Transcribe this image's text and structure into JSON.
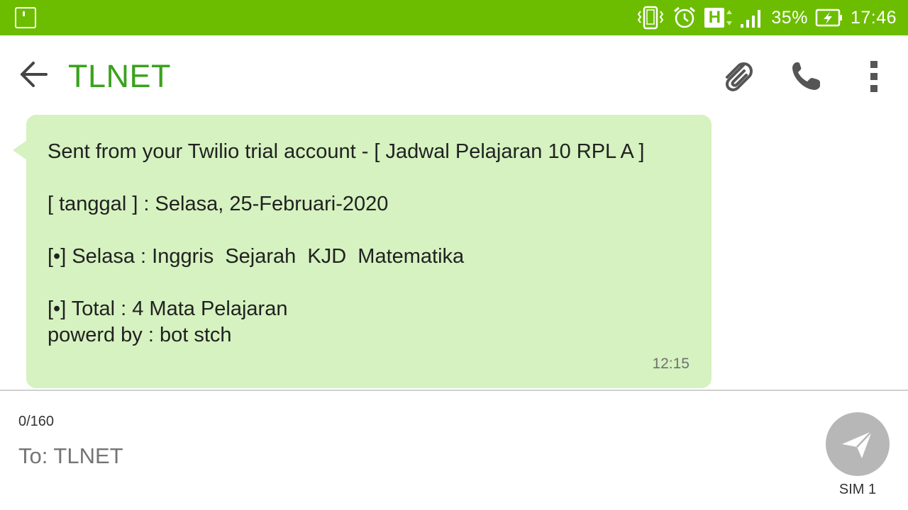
{
  "status_bar": {
    "battery_percent": "35%",
    "time": "17:46",
    "network_type": "H",
    "icons": [
      "notification-icon",
      "vibrate-icon",
      "alarm-icon",
      "network-h-icon",
      "signal-icon",
      "battery-charging-icon"
    ],
    "color": "#6cbd00"
  },
  "header": {
    "title": "TLNET",
    "title_color": "#3aa21d",
    "actions": [
      "back-arrow-icon",
      "attach-icon",
      "phone-icon",
      "more-vert-icon"
    ]
  },
  "message": {
    "lines": [
      "Sent from your Twilio trial account - [ Jadwal Pelajaran 10 RPL A ]",
      "[ tanggal ] : Selasa, 25-Februari-2020",
      "[•] Selasa : Inggris  Sejarah  KJD  Matematika",
      "[•] Total : 4 Mata Pelajaran",
      "powerd by : bot stch"
    ],
    "time": "12:15",
    "bubble_color": "#d5f2c0"
  },
  "compose": {
    "char_count": "0/160",
    "to_placeholder": "To: TLNET",
    "sim_label": "SIM 1",
    "send_button_color": "#b7b7b7"
  }
}
